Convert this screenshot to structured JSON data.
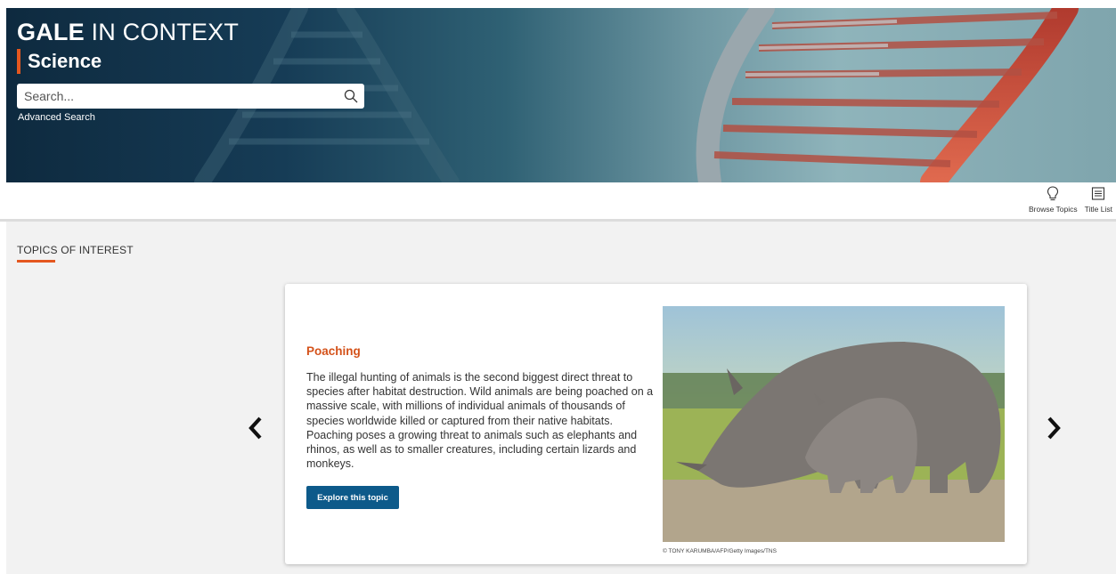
{
  "header": {
    "brand_bold": "GALE",
    "brand_light": " IN CONTEXT",
    "product": "Science",
    "search_placeholder": "Search...",
    "advanced_search": "Advanced Search"
  },
  "toolbar": {
    "browse_topics": "Browse Topics",
    "title_list": "Title List"
  },
  "section": {
    "title": "TOPICS OF INTEREST"
  },
  "carousel": {
    "topic_title": "Poaching",
    "topic_description": "The illegal hunting of animals is the second biggest direct threat to species after habitat destruction. Wild animals are being poached on a massive scale, with millions of individual animals of thousands of species worldwide killed or captured from their native habitats. Poaching poses a growing threat to animals such as elephants and rhinos, as well as to smaller creatures, including certain lizards and monkeys.",
    "explore_button": "Explore this topic",
    "image_credit": "© TONY KARUMBA/AFP/Getty Images/TNS"
  },
  "colors": {
    "accent": "#e4571f",
    "button": "#0d5a8a",
    "topic_title": "#d4521a"
  },
  "icons": [
    "search-icon",
    "lightbulb-icon",
    "list-icon",
    "chevron-left-icon",
    "chevron-right-icon"
  ]
}
